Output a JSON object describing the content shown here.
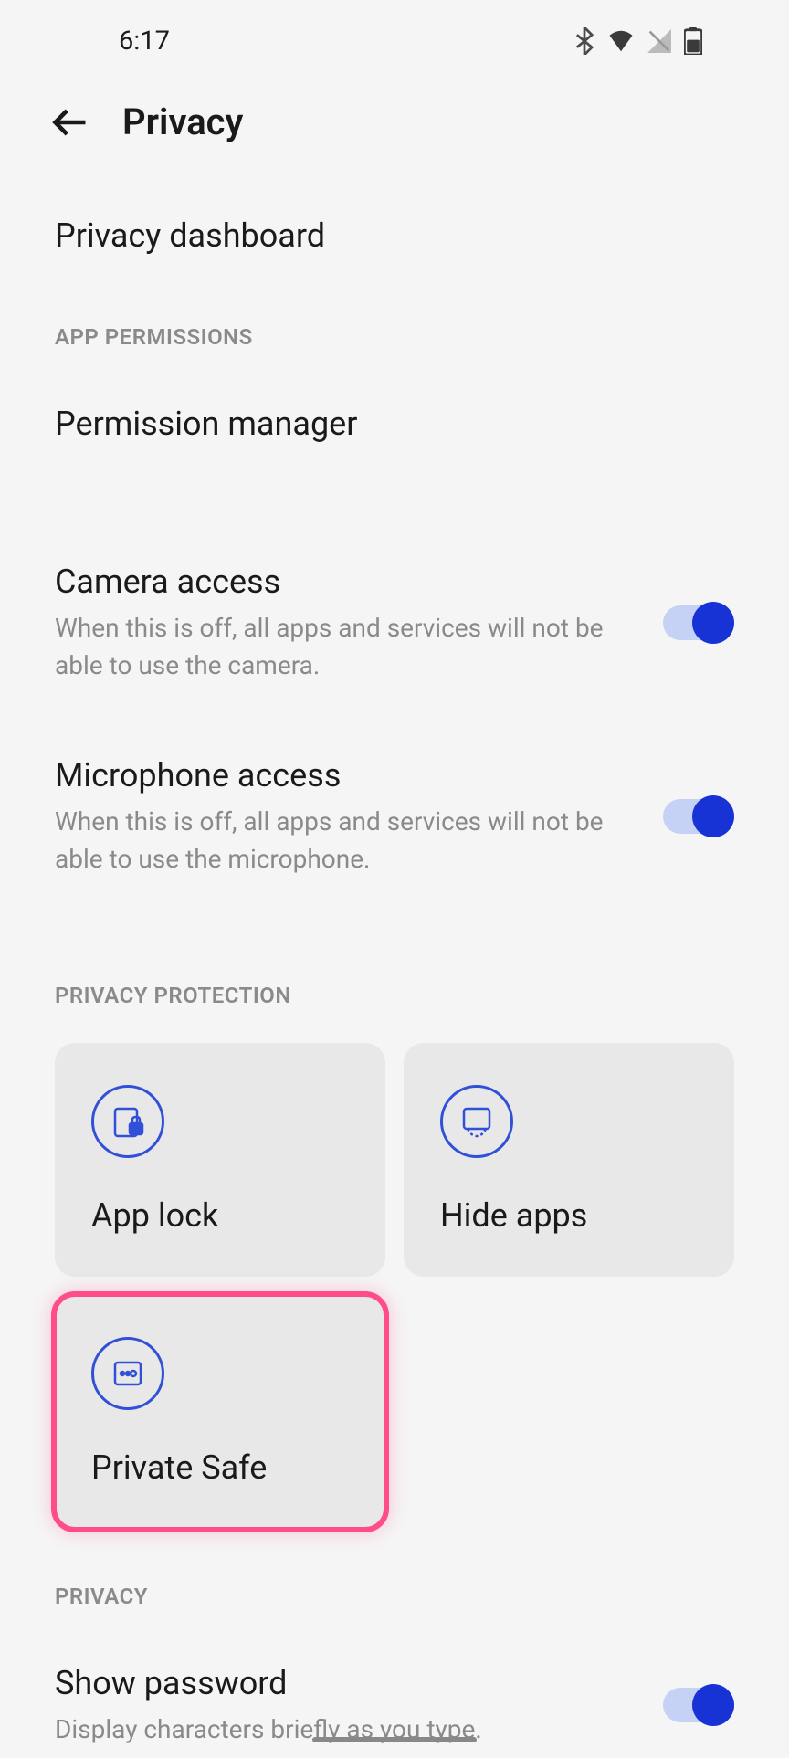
{
  "statusBar": {
    "time": "6:17"
  },
  "header": {
    "title": "Privacy"
  },
  "items": {
    "privacyDashboard": {
      "title": "Privacy dashboard"
    },
    "permissionManager": {
      "title": "Permission manager"
    },
    "cameraAccess": {
      "title": "Camera access",
      "subtitle": "When this is off, all apps and services will not be able to use the camera.",
      "toggle": true
    },
    "microphoneAccess": {
      "title": "Microphone access",
      "subtitle": "When this is off, all apps and services will not be able to use the microphone.",
      "toggle": true
    },
    "showPassword": {
      "title": "Show password",
      "subtitle": "Display characters briefly as you type.",
      "toggle": true
    }
  },
  "sections": {
    "appPermissions": "APP PERMISSIONS",
    "privacyProtection": "PRIVACY PROTECTION",
    "privacy": "PRIVACY"
  },
  "cards": {
    "appLock": "App lock",
    "hideApps": "Hide apps",
    "privateSafe": "Private Safe"
  }
}
